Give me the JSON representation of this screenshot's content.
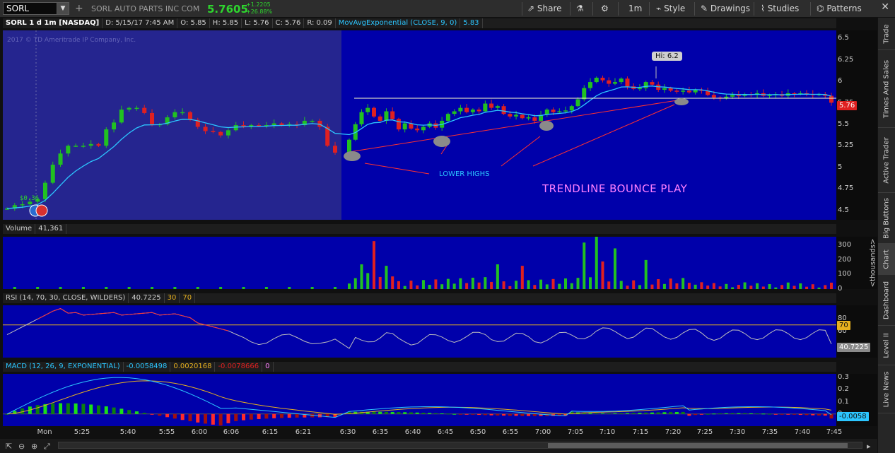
{
  "toolbar": {
    "symbol": "SORL",
    "company": "SORL AUTO PARTS INC COM",
    "last": "5.7605",
    "change": "+1.2205",
    "change_pct": "+26.88%",
    "share": "Share",
    "timeframe": "1m",
    "style": "Style",
    "drawings": "Drawings",
    "studies": "Studies",
    "patterns": "Patterns"
  },
  "price_header": {
    "title": "SORL 1 d 1m [NASDAQ]",
    "date": "D: 5/15/17 7:45 AM",
    "open": "O: 5.85",
    "high": "H: 5.85",
    "low": "L: 5.76",
    "close": "C: 5.76",
    "range": "R: 0.09",
    "study": "MovAvgExponential (CLOSE, 9, 0)",
    "study_val": "5.83"
  },
  "watermark": "2017 © TD Ameritrade IP Company, Inc.",
  "annotations": {
    "hi_label": "Hi: 6.2",
    "lower_highs": "LOWER HIGHS",
    "trendline": "TRENDLINE BOUNCE PLAY",
    "pre_label": "$0.36"
  },
  "price_axis": {
    "ticks": [
      "6.5",
      "6.25",
      "6",
      "5.75",
      "5.5",
      "5.25",
      "5",
      "4.75",
      "4.5"
    ],
    "last_chip": "5.76"
  },
  "volume": {
    "title": "Volume",
    "value": "41,361",
    "ticks": [
      "300",
      "200",
      "100",
      "0"
    ],
    "unit": "<thousands>"
  },
  "rsi": {
    "title": "RSI (14, 70, 30, CLOSE, WILDERS)",
    "value": "40.7225",
    "v30": "30",
    "v70": "70",
    "ticks": [
      "80",
      "60"
    ],
    "chip70": "70",
    "chip_val": "40.7225"
  },
  "macd": {
    "title": "MACD (12, 26, 9, EXPONENTIAL)",
    "v1": "-0.0058498",
    "v2": "0.0020168",
    "v3": "-0.0078666",
    "v4": "0",
    "ticks": [
      "0.3",
      "0.2",
      "0.1",
      "0"
    ],
    "chip": "-0.0058"
  },
  "xaxis": [
    "Mon",
    "5:25",
    "5:40",
    "5:55",
    "6:00",
    "6:06",
    "6:15",
    "6:21",
    "6:30",
    "6:35",
    "6:40",
    "6:45",
    "6:50",
    "6:55",
    "7:00",
    "7:05",
    "7:10",
    "7:15",
    "7:20",
    "7:25",
    "7:30",
    "7:35",
    "7:40",
    "7:45"
  ],
  "sidebar": [
    "Trade",
    "Times And Sales",
    "Active Trader",
    "Big Buttons",
    "Chart",
    "Dashboard",
    "Level II",
    "Live News"
  ],
  "colors": {
    "up": "#21c121",
    "down": "#e02020",
    "ema": "#2cc6ff",
    "bg": "#0000aa",
    "premarket": "#25258f"
  },
  "chart_data": {
    "type": "candlestick",
    "title": "SORL 1 d 1m [NASDAQ]",
    "ylim": [
      4.4,
      6.6
    ],
    "price_ticks": [
      4.5,
      4.75,
      5,
      5.25,
      5.5,
      5.75,
      6,
      6.25,
      6.5
    ],
    "last_price": 5.76,
    "high": 6.2,
    "closes": [
      4.53,
      4.57,
      4.58,
      4.61,
      4.64,
      4.83,
      5.04,
      5.17,
      5.26,
      5.26,
      5.26,
      5.28,
      5.26,
      5.45,
      5.53,
      5.68,
      5.7,
      5.7,
      5.64,
      5.51,
      5.51,
      5.59,
      5.65,
      5.65,
      5.56,
      5.48,
      5.43,
      5.42,
      5.38,
      5.44,
      5.5,
      5.49,
      5.5,
      5.49,
      5.5,
      5.52,
      5.5,
      5.51,
      5.5,
      5.55,
      5.55,
      5.48,
      5.26,
      5.18,
      5.33,
      5.51,
      5.65,
      5.7,
      5.6,
      5.55,
      5.66,
      5.57,
      5.45,
      5.52,
      5.46,
      5.44,
      5.48,
      5.52,
      5.47,
      5.55,
      5.63,
      5.66,
      5.7,
      5.65,
      5.68,
      5.66,
      5.75,
      5.7,
      5.72,
      5.63,
      5.6,
      5.62,
      5.58,
      5.59,
      5.55,
      5.62,
      5.68,
      5.65,
      5.66,
      5.67,
      5.72,
      5.8,
      5.93,
      6.0,
      6.05,
      6.02,
      5.98,
      6.0,
      6.04,
      5.95,
      5.92,
      5.93,
      6.0,
      5.97,
      5.91,
      5.93,
      5.9,
      5.89,
      5.9,
      5.88,
      5.91,
      5.9,
      5.85,
      5.82,
      5.81,
      5.83,
      5.85,
      5.84,
      5.86,
      5.85,
      5.87,
      5.84,
      5.85,
      5.86,
      5.84,
      5.87,
      5.86,
      5.87,
      5.86,
      5.85,
      5.86,
      5.84,
      5.76
    ],
    "ema9_last": 5.83,
    "volume_ticks_thousands": [
      0,
      100,
      200,
      300
    ],
    "rsi_last": 40.7225,
    "rsi_levels": [
      30,
      70
    ],
    "macd": {
      "value": -0.0058498,
      "avg": 0.0020168,
      "diff": -0.0078666
    }
  }
}
